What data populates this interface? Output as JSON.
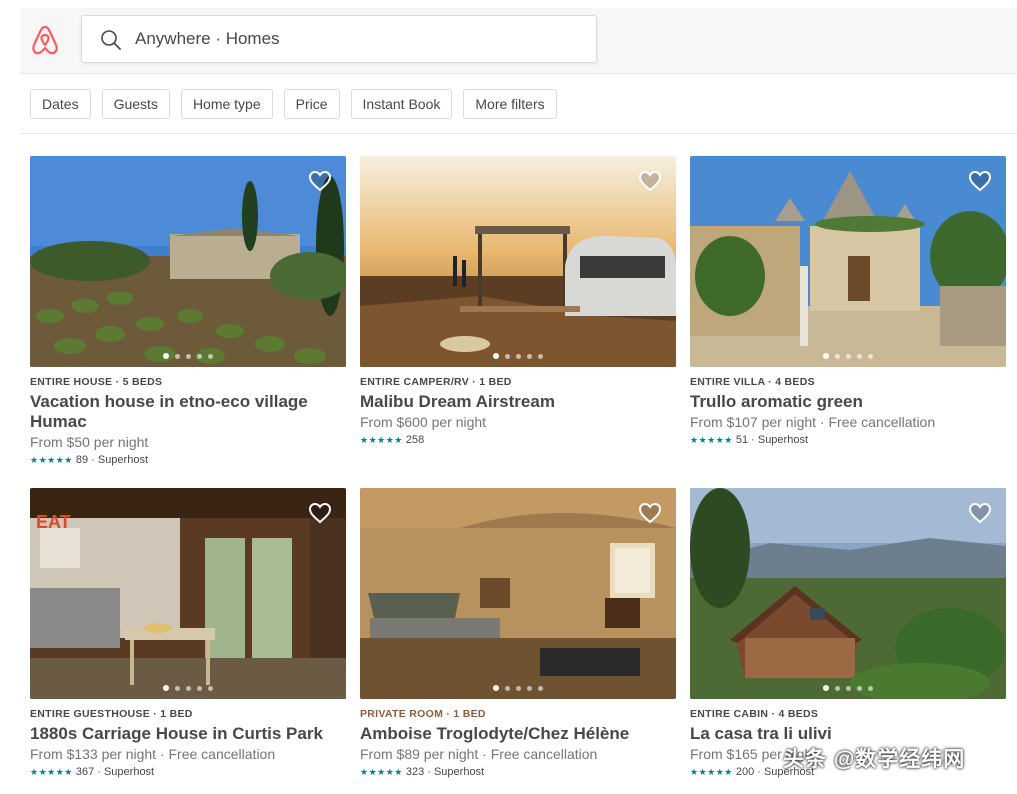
{
  "brand": {
    "logo_icon": "airbnb-belo-icon",
    "accent": "#ff5a5f"
  },
  "search": {
    "icon": "search-icon",
    "text": "Anywhere · Homes"
  },
  "filters": [
    {
      "label": "Dates"
    },
    {
      "label": "Guests"
    },
    {
      "label": "Home type"
    },
    {
      "label": "Price"
    },
    {
      "label": "Instant Book"
    },
    {
      "label": "More filters"
    }
  ],
  "listings": [
    {
      "kind": "ENTIRE HOUSE · 5 BEDS",
      "title": "Vacation house in etno-eco village Humac",
      "price": "From $50  per night",
      "stars": "★★★★★",
      "rating": "89 · Superhost"
    },
    {
      "kind": "ENTIRE CAMPER/RV · 1 BED",
      "title": "Malibu Dream Airstream",
      "price": "From $600  per night",
      "stars": "★★★★★",
      "rating": "258"
    },
    {
      "kind": "ENTIRE VILLA · 4 BEDS",
      "title": "Trullo aromatic green",
      "price": "From $107  per night · Free cancellation",
      "stars": "★★★★★",
      "rating": "51 · Superhost"
    },
    {
      "kind": "ENTIRE GUESTHOUSE · 1 BED",
      "title": "1880s Carriage House in Curtis Park",
      "price": "From $133  per night · Free cancellation",
      "stars": "★★★★★",
      "rating": "367 · Superhost"
    },
    {
      "kind": "PRIVATE ROOM · 1 BED",
      "title": "Amboise Troglodyte/Chez Hélène",
      "price": "From $89  per night · Free cancellation",
      "stars": "★★★★★",
      "rating": "323 · Superhost"
    },
    {
      "kind": "ENTIRE CABIN · 4 BEDS",
      "title": "La casa tra li ulivi",
      "price": "From $165  per night",
      "stars": "★★★★★",
      "rating": "200 · Superhost"
    }
  ],
  "watermark": "头条 @数学经纬网"
}
